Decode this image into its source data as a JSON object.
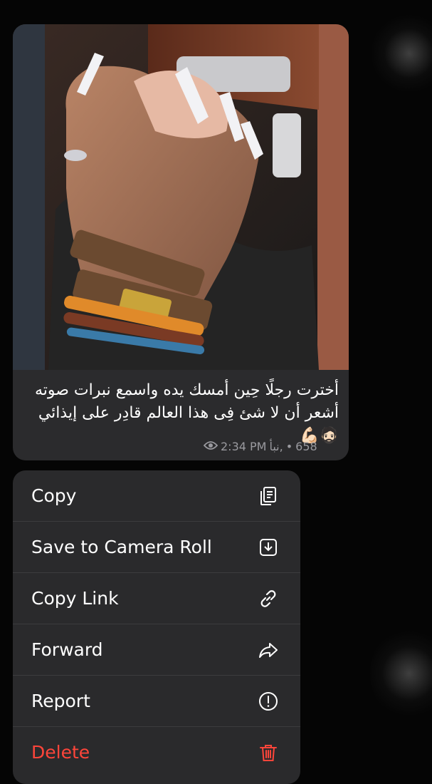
{
  "message": {
    "caption": "أخترت رجلًا حِين أمسك يده واسمع نبرات صوته  أشعر أن لا شئ فِى هذا العالم قادِر على إيذائي 🧔🏻💪🏻",
    "views": "658",
    "time": "2:34 PM",
    "author": "نبأ,",
    "separator": "•",
    "view_icon": "eye-icon"
  },
  "context_menu": {
    "items": [
      {
        "label": "Copy",
        "icon": "copy-icon",
        "destructive": false
      },
      {
        "label": "Save to Camera Roll",
        "icon": "download-icon",
        "destructive": false
      },
      {
        "label": "Copy Link",
        "icon": "link-icon",
        "destructive": false
      },
      {
        "label": "Forward",
        "icon": "forward-arrow-icon",
        "destructive": false
      },
      {
        "label": "Report",
        "icon": "exclamation-circle-icon",
        "destructive": false
      },
      {
        "label": "Delete",
        "icon": "trash-icon",
        "destructive": true
      }
    ]
  },
  "colors": {
    "background": "#050505",
    "bubble": "#2b2b2d",
    "menu": "#2a2a2c",
    "destructive": "#ff453a",
    "meta_text": "#9a9a9f"
  }
}
